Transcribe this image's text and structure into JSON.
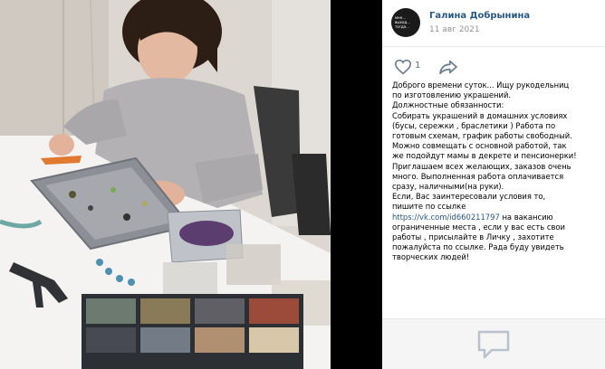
{
  "post": {
    "author": "Галина Добрынина",
    "date": "11 авг 2021",
    "avatar_text": "мне... выход... тогда...",
    "likes": "1",
    "lines": {
      "l1": "Доброго времени суток... Ищу рукодельниц",
      "l2": "по изготовлению украшений.",
      "l3": "Должностные обязанности:",
      "l4": "Собирать украшений в домашних условиях",
      "l5": "(бусы, сережки , браслетики ) Работа по",
      "l6": "готовым схемам, график работы свободный.",
      "l7": "Можно совмещать с основной работой, так",
      "l8": "же подойдут мамы в декрете и пенсионерки!",
      "l9": "Приглашаем всех желающих, заказов очень",
      "l10": "много. Выполненная работа оплачивается",
      "l11": "сразу, наличными(на руки).",
      "l12": "Если, Вас заинтересовали условия то,",
      "l13": "пишите по ссылке",
      "l14_link": "https://vk.com/id660211797",
      "l14_rest": " на вакансию",
      "l15": "ограниченные места , если у вас есть свои",
      "l16": "работы , присылайте в Личку , захотите",
      "l17": "пожалуйста по ссылке. Рада буду увидеть",
      "l18": "творческих людей!"
    }
  },
  "icons": {
    "like": "heart-outline-icon",
    "share": "share-arrow-icon",
    "comment": "comment-bubble-icon"
  },
  "colors": {
    "link": "#2a5885",
    "muted": "#939393",
    "background": "#000000"
  }
}
